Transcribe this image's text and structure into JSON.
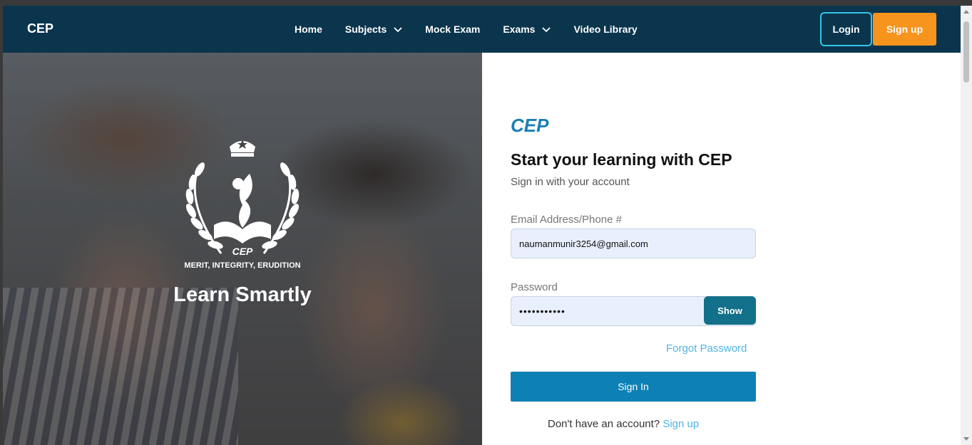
{
  "nav": {
    "brand": "CEP",
    "items": [
      {
        "label": "Home",
        "dropdown": false
      },
      {
        "label": "Subjects",
        "dropdown": true
      },
      {
        "label": "Mock Exam",
        "dropdown": false
      },
      {
        "label": "Exams",
        "dropdown": true
      },
      {
        "label": "Video Library",
        "dropdown": false
      }
    ],
    "login_label": "Login",
    "signup_label": "Sign up"
  },
  "hero": {
    "emblem_text": "CEP",
    "motto": "MERIT, INTEGRITY, ERUDITION",
    "tagline": "Learn Smartly"
  },
  "form": {
    "logo_text": "CEP",
    "title": "Start your learning with CEP",
    "subtitle": "Sign in with your account",
    "email_label": "Email Address/Phone #",
    "email_value": "naumanmunir3254@gmail.com",
    "password_label": "Password",
    "password_value": "•••••••••••",
    "show_label": "Show",
    "forgot_label": "Forgot Password",
    "signin_label": "Sign In",
    "no_account_text": "Don't have an account?",
    "signup_link": "Sign up"
  },
  "colors": {
    "nav_bg": "#0b354d",
    "accent_orange": "#f7941d",
    "primary_blue": "#0d80b5",
    "link_blue": "#4fb3e6",
    "show_button": "#13708a"
  },
  "icons": {
    "dropdown": "chevron-down-icon",
    "emblem": "laurel-wreath-emblem",
    "logo": "cep-logo"
  }
}
